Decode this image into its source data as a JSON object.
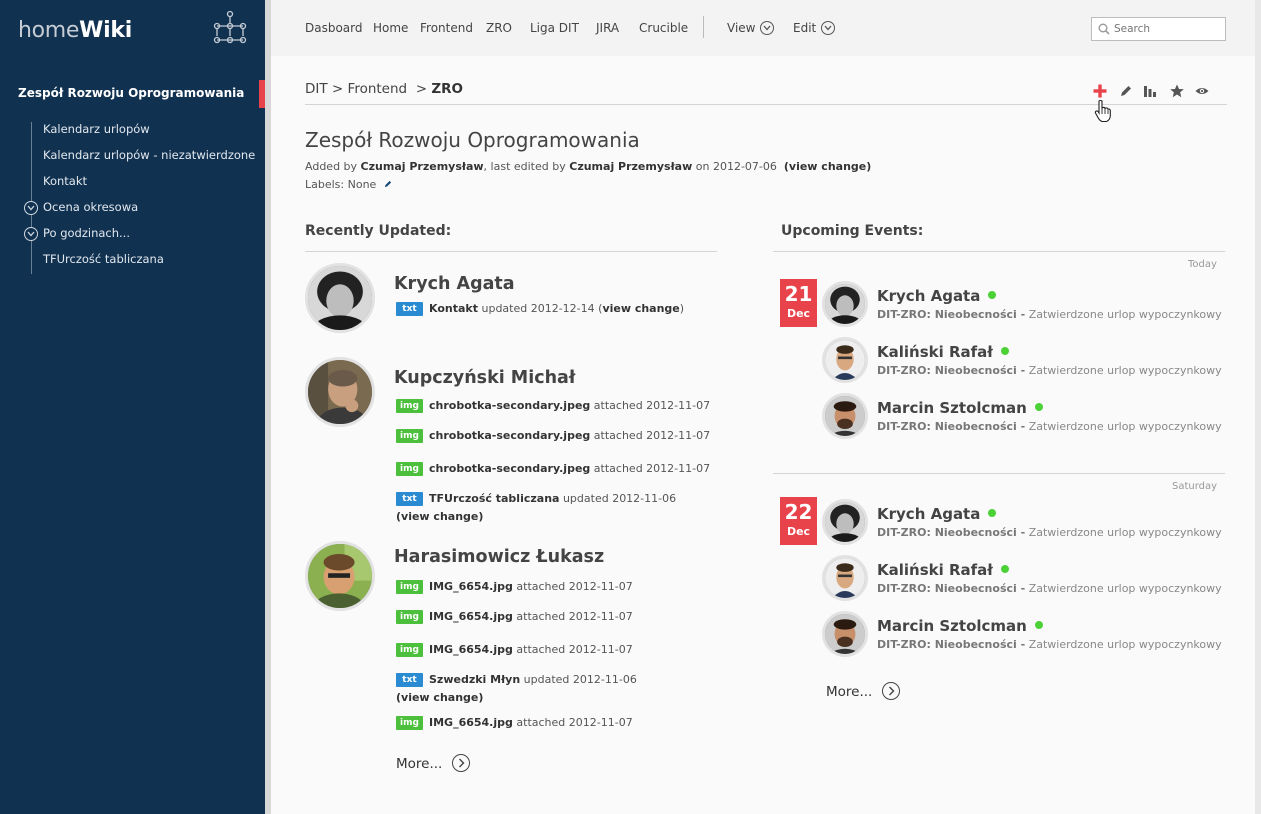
{
  "brand": {
    "light": "home",
    "bold": "Wiki"
  },
  "sidebar": {
    "space_title": "Zespół Rozwoju Oprogramowania",
    "items": [
      {
        "label": "Kalendarz urlopów"
      },
      {
        "label": "Kalendarz urlopów - niezatwierdzone"
      },
      {
        "label": "Kontakt"
      },
      {
        "label": "Ocena okresowa"
      },
      {
        "label": "Po godzinach..."
      },
      {
        "label": "TFUrczość tabliczana"
      }
    ]
  },
  "nav": {
    "items": [
      "Dasboard",
      "Home",
      "Frontend",
      "ZRO",
      "Liga DIT",
      "JIRA",
      "Crucible"
    ],
    "view": "View",
    "edit": "Edit",
    "search_placeholder": "Search"
  },
  "breadcrumb": {
    "part1": "DIT",
    "sep1": ">",
    "part2": "Frontend",
    "sep2": ">",
    "current": "ZRO"
  },
  "page": {
    "title": "Zespół Rozwoju Oprogramowania",
    "added_by_label": "Added by",
    "author": "Czumaj Przemysław",
    "last_edited_label": ", last edited by",
    "editor": "Czumaj Przemysław",
    "on_label": "on 2012-07-06",
    "view_change": "(view change)",
    "labels_text": "Labels: None"
  },
  "recently_updated": {
    "heading": "Recently Updated:",
    "people": [
      {
        "name": "Krych Agata",
        "updates": [
          {
            "type": "txt",
            "title": "Kontakt",
            "action": "updated 2012-12-14 (",
            "link": "view change",
            "tail": ")"
          }
        ]
      },
      {
        "name": "Kupczyński Michał",
        "updates": [
          {
            "type": "img",
            "title": "chrobotka-secondary.jpeg",
            "action": "attached 2012-11-07"
          },
          {
            "type": "img",
            "title": "chrobotka-secondary.jpeg",
            "action": "attached 2012-11-07"
          },
          {
            "type": "img",
            "title": "chrobotka-secondary.jpeg",
            "action": "attached 2012-11-07"
          },
          {
            "type": "txt",
            "title": "TFUrczość tabliczana",
            "action": "updated 2012-11-06",
            "link2": "(view change)"
          }
        ]
      },
      {
        "name": "Harasimowicz Łukasz",
        "updates": [
          {
            "type": "img",
            "title": "IMG_6654.jpg",
            "action": "attached 2012-11-07"
          },
          {
            "type": "img",
            "title": "IMG_6654.jpg",
            "action": "attached 2012-11-07"
          },
          {
            "type": "img",
            "title": "IMG_6654.jpg",
            "action": "attached 2012-11-07"
          },
          {
            "type": "txt",
            "title": "Szwedzki Młyn",
            "action": "updated 2012-11-06",
            "link2": "(view change)"
          },
          {
            "type": "img",
            "title": "IMG_6654.jpg",
            "action": "attached 2012-11-07"
          }
        ]
      }
    ],
    "more": "More..."
  },
  "upcoming_events": {
    "heading": "Upcoming Events:",
    "days": [
      {
        "label": "Today",
        "day": "21",
        "month": "Dec",
        "events": [
          {
            "name": "Krych Agata",
            "space": "DIT-ZRO: Nieobecności -",
            "desc": "Zatwierdzone urlop wypoczynkowy"
          },
          {
            "name": "Kaliński Rafał",
            "space": "DIT-ZRO: Nieobecności -",
            "desc": "Zatwierdzone urlop wypoczynkowy"
          },
          {
            "name": "Marcin Sztolcman",
            "space": "DIT-ZRO: Nieobecności -",
            "desc": "Zatwierdzone urlop wypoczynkowy"
          }
        ]
      },
      {
        "label": "Saturday",
        "day": "22",
        "month": "Dec",
        "events": [
          {
            "name": "Krych Agata",
            "space": "DIT-ZRO: Nieobecności -",
            "desc": "Zatwierdzone urlop wypoczynkowy"
          },
          {
            "name": "Kaliński Rafał",
            "space": "DIT-ZRO: Nieobecności -",
            "desc": "Zatwierdzone urlop wypoczynkowy"
          },
          {
            "name": "Marcin Sztolcman",
            "space": "DIT-ZRO: Nieobecności -",
            "desc": "Zatwierdzone urlop wypoczynkowy"
          }
        ]
      }
    ],
    "more": "More..."
  },
  "colors": {
    "sidebar_bg": "#113150",
    "accent_red": "#e8434b",
    "badge_txt": "#2a8ad2",
    "badge_img": "#4cbf3c",
    "online": "#4cd137"
  },
  "icons": {
    "toolbar": [
      "plus-icon",
      "pencil-icon",
      "bar-chart-icon",
      "star-icon",
      "eye-icon"
    ],
    "cursor": "hand-pointer-icon"
  }
}
